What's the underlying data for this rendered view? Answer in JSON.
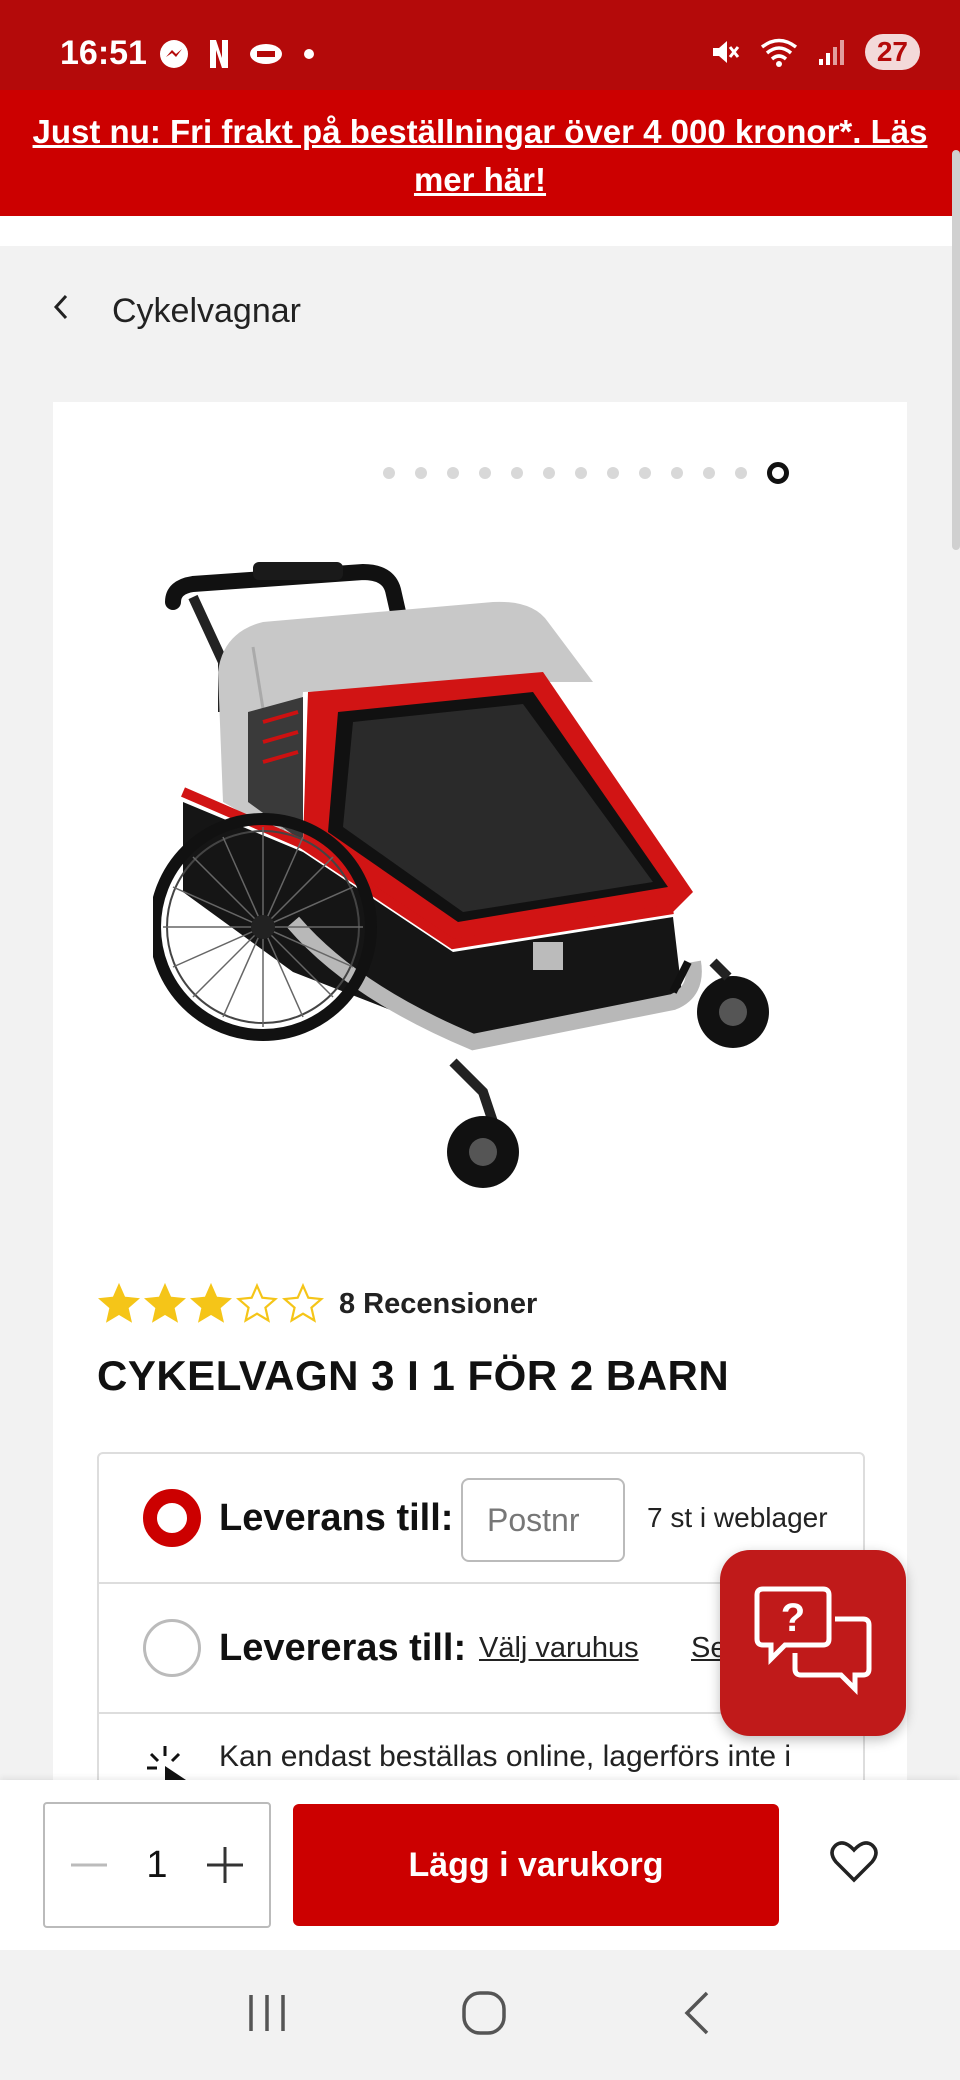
{
  "status_bar": {
    "time": "16:51",
    "battery": "27",
    "icons_left": [
      "messenger-icon",
      "netflix-icon",
      "app-badge-icon",
      "dot-icon"
    ],
    "icons_right": [
      "mute-icon",
      "wifi-icon",
      "signal-icon"
    ]
  },
  "promo": {
    "text": "Just nu: Fri frakt på beställningar över 4 000 kronor*. Läs mer här!"
  },
  "breadcrumb": {
    "label": "Cykelvagnar"
  },
  "gallery": {
    "total_images": 13,
    "active_index": 12
  },
  "product": {
    "rating": 3,
    "rating_max": 5,
    "reviews_label": "8 Recensioner",
    "title": "CYKELVAGN 3 I 1 FÖR 2 BARN"
  },
  "delivery": {
    "delivery_label": "Leverans till:",
    "postnr_placeholder": "Postnr",
    "stock_text": "7 st i weblager",
    "pickup_label": "Levereras till:",
    "choose_store": "Välj varuhus",
    "see_more": "Se bu",
    "info_text": "Kan endast beställas online, lagerförs inte i"
  },
  "cart": {
    "quantity": "1",
    "add_label": "Lägg i varukorg"
  },
  "colors": {
    "brand_red": "#cc0000",
    "status_red": "#b40a0a",
    "star_yellow": "#f5c518"
  }
}
